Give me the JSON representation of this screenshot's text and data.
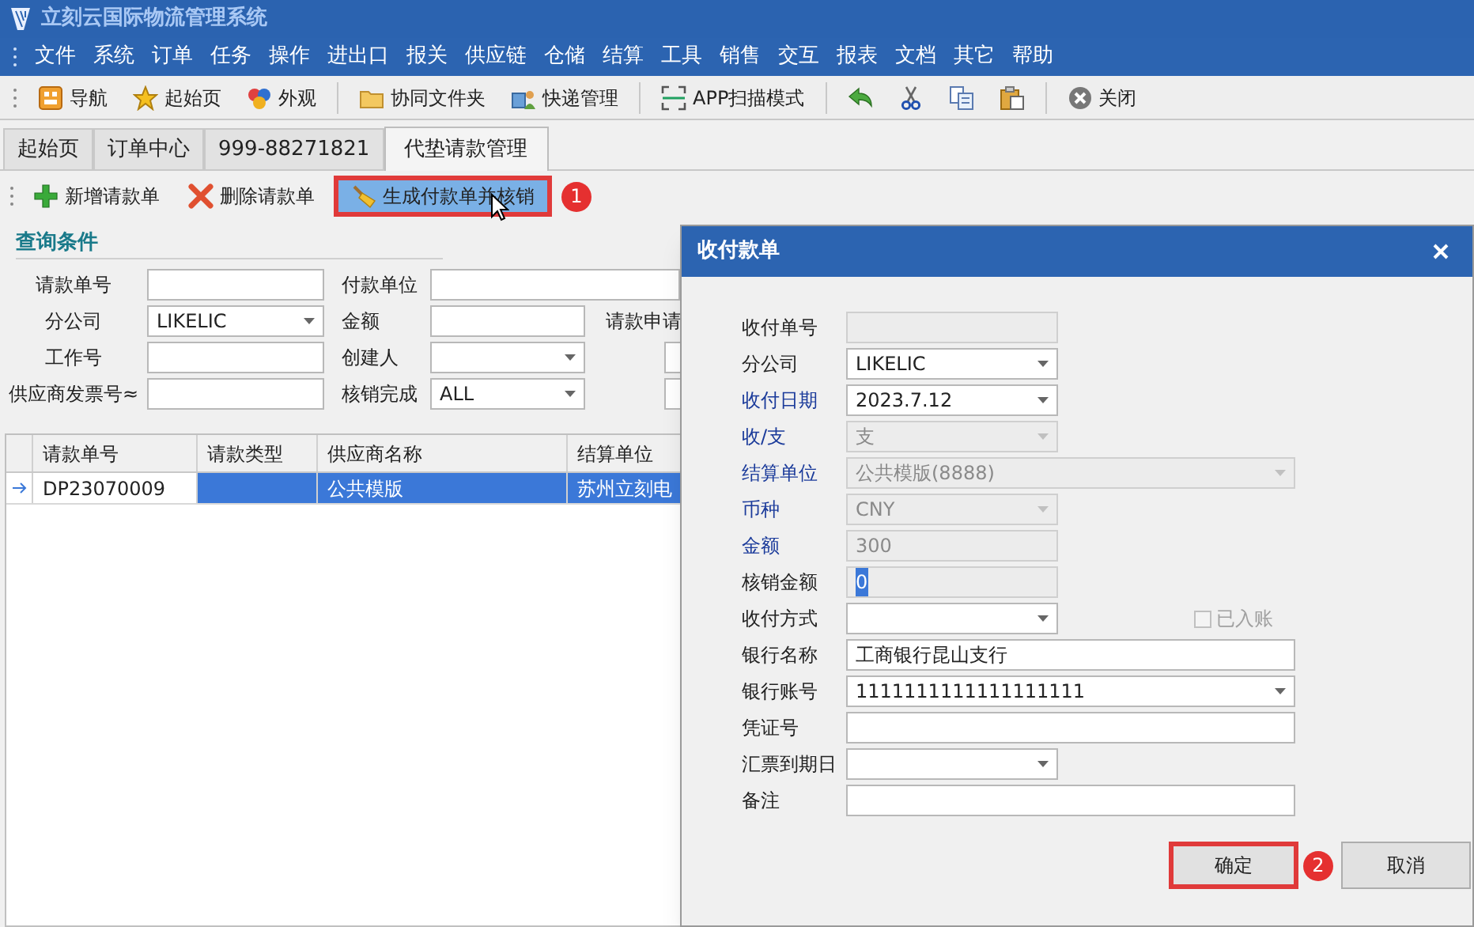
{
  "window": {
    "title": "立刻云国际物流管理系统"
  },
  "menu": [
    "文件",
    "系统",
    "订单",
    "任务",
    "操作",
    "进出口",
    "报关",
    "供应链",
    "仓储",
    "结算",
    "工具",
    "销售",
    "交互",
    "报表",
    "文档",
    "其它",
    "帮助"
  ],
  "toolbar": [
    {
      "kind": "nav",
      "label": "导航"
    },
    {
      "kind": "home",
      "label": "起始页"
    },
    {
      "kind": "skin",
      "label": "外观"
    },
    {
      "kind": "separator"
    },
    {
      "kind": "folder",
      "label": "协同文件夹"
    },
    {
      "kind": "courier",
      "label": "快递管理"
    },
    {
      "kind": "separator"
    },
    {
      "kind": "scan",
      "label": "APP扫描模式"
    },
    {
      "kind": "separator"
    },
    {
      "kind": "undo"
    },
    {
      "kind": "cut"
    },
    {
      "kind": "copy"
    },
    {
      "kind": "paste"
    },
    {
      "kind": "separator"
    },
    {
      "kind": "close",
      "label": "关闭"
    }
  ],
  "tabs": [
    {
      "label": "起始页",
      "selected": false
    },
    {
      "label": "订单中心",
      "selected": false
    },
    {
      "label": "999-88271821",
      "selected": false
    },
    {
      "label": "代垫请款管理",
      "selected": true
    }
  ],
  "actions": [
    {
      "kind": "add",
      "label": "新增请款单",
      "highlighted": false
    },
    {
      "kind": "delete",
      "label": "删除请款单",
      "highlighted": false
    },
    {
      "kind": "generate",
      "label": "生成付款单并核销",
      "highlighted": true,
      "badge": "1"
    }
  ],
  "query": {
    "title": "查询条件",
    "rows": [
      [
        {
          "label": "请款单号",
          "kind": "text"
        },
        {
          "label": "付款单位",
          "kind": "text"
        }
      ],
      [
        {
          "label": "分公司",
          "kind": "dropdown",
          "value": "LIKELIC"
        },
        {
          "label": "金额",
          "kind": "text"
        },
        {
          "label": "请款申请",
          "kind": "label"
        }
      ],
      [
        {
          "label": "工作号",
          "kind": "text"
        },
        {
          "label": "创建人",
          "kind": "dropdown"
        },
        {
          "kind": "stub"
        }
      ],
      [
        {
          "label": "供应商发票号≈",
          "kind": "text"
        },
        {
          "label": "核销完成",
          "kind": "dropdown",
          "value": "ALL"
        },
        {
          "kind": "stub"
        }
      ]
    ]
  },
  "grid": {
    "columns": [
      "请款单号",
      "请款类型",
      "供应商名称",
      "结算单位"
    ],
    "rows": [
      {
        "selected": true,
        "cells": [
          "DP23070009",
          null,
          "公共模版",
          "苏州立刻电"
        ]
      }
    ]
  },
  "dialog": {
    "title": "收付款单",
    "fields": [
      {
        "label": "收付单号",
        "kind": "text",
        "disabled": true,
        "required": false
      },
      {
        "label": "分公司",
        "kind": "dropdown",
        "value": "LIKELIC",
        "disabled": false,
        "required": false
      },
      {
        "label": "收付日期",
        "kind": "dropdown",
        "value": "2023.7.12",
        "disabled": false,
        "required": true
      },
      {
        "label": "收/支",
        "kind": "dropdown",
        "value": "支",
        "disabled": true,
        "required": true
      },
      {
        "label": "结算单位",
        "kind": "dropdown",
        "value": "公共模版(8888)",
        "disabled": true,
        "required": true
      },
      {
        "label": "币种",
        "kind": "dropdown",
        "value": "CNY",
        "disabled": true,
        "required": true
      },
      {
        "label": "金额",
        "kind": "text",
        "value": "300",
        "disabled": true,
        "required": true
      },
      {
        "label": "核销金额",
        "kind": "text",
        "value": "0",
        "disabled": true,
        "required": false,
        "text_selected": true
      },
      {
        "label": "收付方式",
        "kind": "dropdown",
        "disabled": false,
        "required": false,
        "checkbox": {
          "label": "已入账",
          "checked": false,
          "disabled": true
        }
      },
      {
        "label": "银行名称",
        "kind": "text",
        "value": "工商银行昆山支行",
        "disabled": false,
        "required": false
      },
      {
        "label": "银行账号",
        "kind": "dropdown",
        "value": "1111111111111111111",
        "disabled": false,
        "required": false
      },
      {
        "label": "凭证号",
        "kind": "text",
        "disabled": false,
        "required": false
      },
      {
        "label": "汇票到期日",
        "kind": "dropdown",
        "disabled": false,
        "required": false
      },
      {
        "label": "备注",
        "kind": "text",
        "disabled": false,
        "required": false
      }
    ],
    "buttons": [
      {
        "label": "确定",
        "highlighted": true,
        "badge": "2"
      },
      {
        "label": "取消",
        "highlighted": false
      }
    ]
  }
}
